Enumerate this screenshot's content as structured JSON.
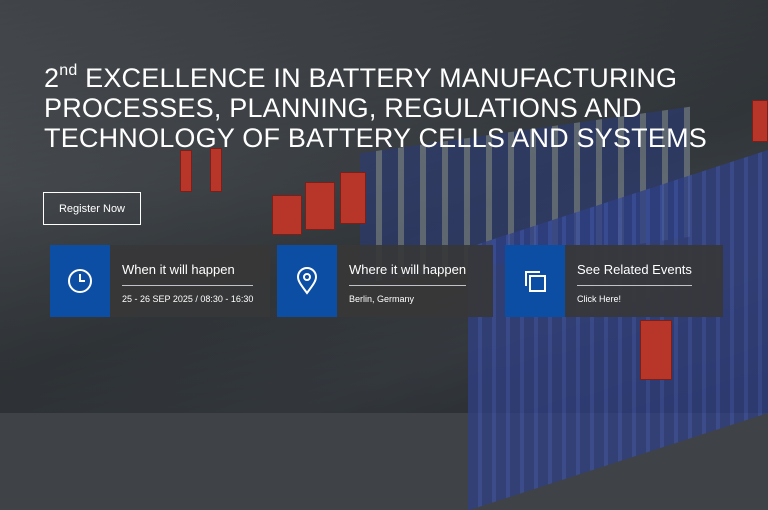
{
  "hero": {
    "title_prefix": "2",
    "title_sup": "nd",
    "title_rest": " EXCELLENCE IN BATTERY MANUFACTURING PROCESSES, PLANNING, REGULATIONS AND TECHNOLOGY OF BATTERY CELLS AND SYSTEMS",
    "register_label": "Register Now"
  },
  "cards": {
    "when": {
      "icon": "clock-icon",
      "heading": "When it will happen",
      "detail": "25 - 26 SEP 2025 / 08:30 - 16:30"
    },
    "where": {
      "icon": "location-pin-icon",
      "heading": "Where it will happen",
      "detail": "Berlin, Germany"
    },
    "related": {
      "icon": "copy-squares-icon",
      "heading": "See Related Events",
      "detail": "Click Here!"
    }
  },
  "colors": {
    "accent_blue": "#0c4ea3",
    "card_bg": "#373738",
    "text": "#ffffff"
  }
}
